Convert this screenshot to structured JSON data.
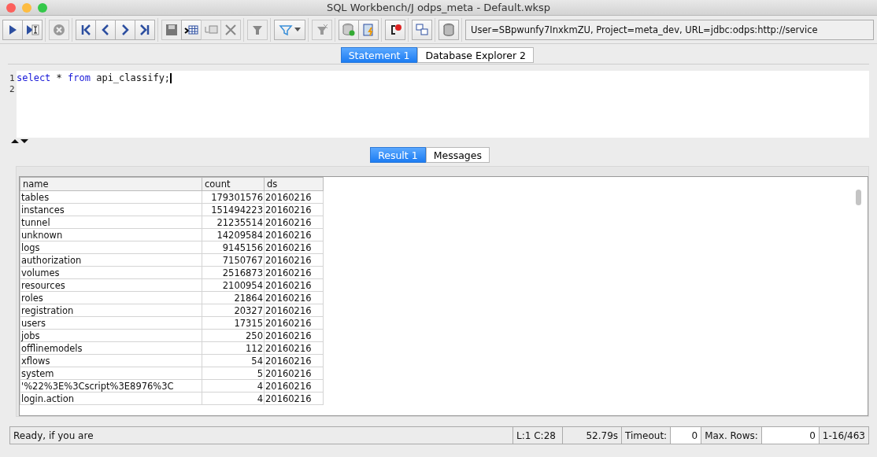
{
  "window": {
    "title": "SQL Workbench/J odps_meta - Default.wksp"
  },
  "toolbar": [
    [
      {
        "kind": "run",
        "disabled": false
      },
      {
        "kind": "run-current",
        "disabled": false
      }
    ],
    [
      {
        "kind": "stop",
        "disabled": true
      }
    ],
    [
      {
        "kind": "first",
        "disabled": false
      },
      {
        "kind": "prev",
        "disabled": false
      },
      {
        "kind": "next",
        "disabled": false
      },
      {
        "kind": "last",
        "disabled": false
      }
    ],
    [
      {
        "kind": "save",
        "disabled": true
      },
      {
        "kind": "edit",
        "disabled": false
      },
      {
        "kind": "copy-row",
        "disabled": true
      },
      {
        "kind": "delete",
        "disabled": true
      }
    ],
    [
      {
        "kind": "funnel",
        "disabled": true
      }
    ],
    [
      {
        "kind": "filter",
        "disabled": false
      }
    ],
    [
      {
        "kind": "filter-remove",
        "disabled": true
      }
    ],
    [
      {
        "kind": "commit",
        "disabled": false
      },
      {
        "kind": "rollback",
        "disabled": false
      }
    ],
    [
      {
        "kind": "alert",
        "disabled": false
      }
    ],
    [
      {
        "kind": "tables",
        "disabled": false
      }
    ],
    [
      {
        "kind": "database",
        "disabled": false
      }
    ]
  ],
  "connection_info": "User=SBpwunfy7InxkmZU, Project=meta_dev, URL=jdbc:odps:http://service",
  "tabs": [
    {
      "label": "Statement 1",
      "selected": true
    },
    {
      "label": "Database Explorer 2",
      "selected": false
    }
  ],
  "editor": {
    "lines": [
      {
        "number": "1",
        "keyword1": "select",
        "rest1": " * ",
        "keyword2": "from",
        "rest2": " api_classify;"
      },
      {
        "number": "2"
      }
    ]
  },
  "result_tabs": [
    {
      "label": "Result 1",
      "selected": true
    },
    {
      "label": "Messages",
      "selected": false
    }
  ],
  "table": {
    "columns": [
      "name",
      "count",
      "ds"
    ],
    "rows": [
      [
        "tables",
        "179301576",
        "20160216"
      ],
      [
        "instances",
        "151494223",
        "20160216"
      ],
      [
        "tunnel",
        "21235514",
        "20160216"
      ],
      [
        "unknown",
        "14209584",
        "20160216"
      ],
      [
        "logs",
        "9145156",
        "20160216"
      ],
      [
        "authorization",
        "7150767",
        "20160216"
      ],
      [
        "volumes",
        "2516873",
        "20160216"
      ],
      [
        "resources",
        "2100954",
        "20160216"
      ],
      [
        "roles",
        "21864",
        "20160216"
      ],
      [
        "registration",
        "20327",
        "20160216"
      ],
      [
        "users",
        "17315",
        "20160216"
      ],
      [
        "jobs",
        "250",
        "20160216"
      ],
      [
        "offlinemodels",
        "112",
        "20160216"
      ],
      [
        "xflows",
        "54",
        "20160216"
      ],
      [
        "system",
        "5",
        "20160216"
      ],
      [
        "'%22%3E%3Cscript%3E8976%3C",
        "4",
        "20160216"
      ],
      [
        "login.action",
        "4",
        "20160216"
      ]
    ]
  },
  "status_bar": {
    "message": "Ready, if you are",
    "position": "L:1 C:28",
    "elapsed": "52.79s",
    "timeout_label": "Timeout:",
    "timeout_value": "0",
    "max_rows_label": "Max. Rows:",
    "max_rows_value": "0",
    "rows": "1-16/463"
  }
}
